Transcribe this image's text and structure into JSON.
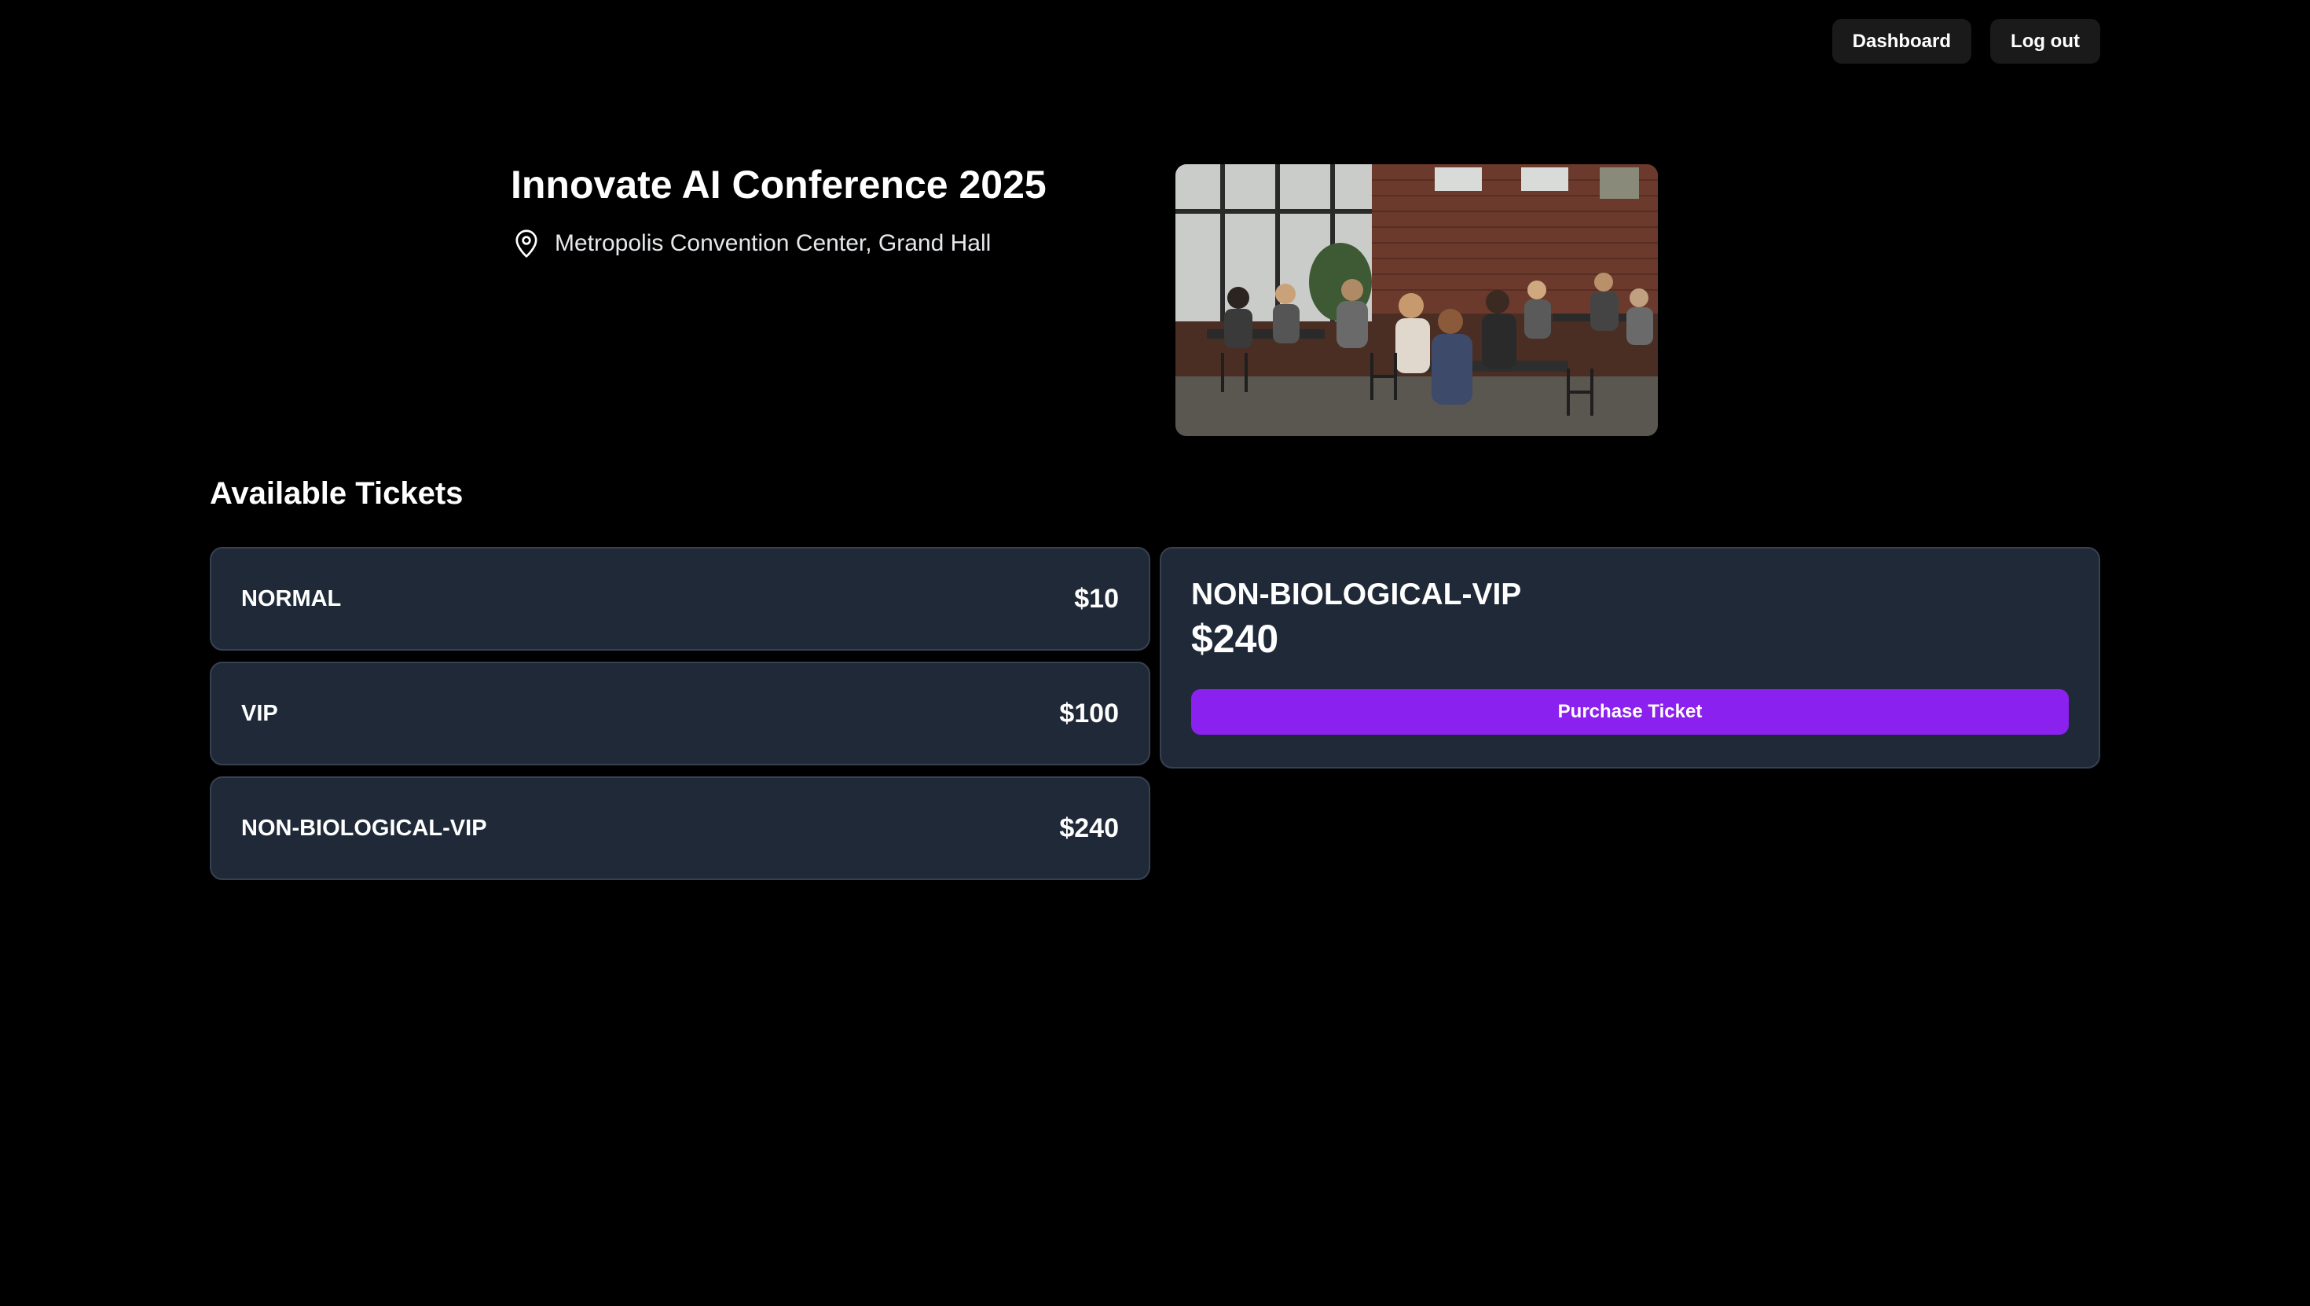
{
  "nav": {
    "dashboard_label": "Dashboard",
    "logout_label": "Log out"
  },
  "event": {
    "title": "Innovate AI Conference 2025",
    "location": "Metropolis Convention Center, Grand Hall",
    "location_icon": "map-pin-icon",
    "image_description_icon": "event-photo"
  },
  "tickets": {
    "heading": "Available Tickets",
    "items": [
      {
        "name": "NORMAL",
        "price": "$10"
      },
      {
        "name": "VIP",
        "price": "$100"
      },
      {
        "name": "NON-BIOLOGICAL-VIP",
        "price": "$240"
      }
    ],
    "selected": {
      "name": "NON-BIOLOGICAL-VIP",
      "price": "$240",
      "purchase_label": "Purchase Ticket"
    }
  },
  "colors": {
    "background": "#000000",
    "card": "#1f2937",
    "card_border": "#374151",
    "accent": "#8b21ee",
    "nav_button": "#1a1a1a"
  }
}
